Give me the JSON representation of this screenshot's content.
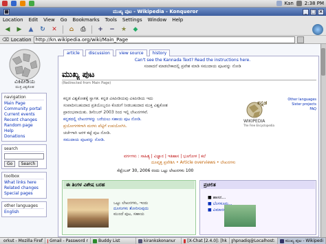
{
  "top_panel": {
    "user": "Kan",
    "clock": "2:38 PM"
  },
  "window": {
    "title": "ಮುಖ್ಯ ಪುಟ - Wikipedia - Konqueror"
  },
  "menu": [
    "Location",
    "Edit",
    "View",
    "Go",
    "Bookmarks",
    "Tools",
    "Settings",
    "Window",
    "Help"
  ],
  "location": {
    "label": "Location",
    "url": "http://kn.wikipedia.org/wiki/Main_Page"
  },
  "logo_text": "ವಿಕಿಪೀಡಿಯ",
  "logo_sub": "ಮುಕ್ತ ವಿಶ್ವಕೋಶ",
  "tabs": [
    "article",
    "discussion",
    "view source",
    "history"
  ],
  "notice": "Can't see the Kannada Text? Read the instructions here.",
  "notice2": "ಸಂಪಾದನೆ ಮಾಡಲೇಕಾದಲ್ಲಿ ಪ್ರವೇಶ ಮಾಡಿ ಸಮುದಾಯ ಪುಟವನ್ನು ನೋಡಿ",
  "heading": "ಮುಖ್ಯ ಪುಟ",
  "redirected": "(Redirected from Main Page)",
  "paragraphs": [
    "ಕನ್ನಡ ವಿಶ್ವಕೋಶಕ್ಕೆ ಸ್ವಾಗತ. ಕನ್ನಡ ವಿಕಿಪೀಡಿಯವು ವಿಕಿಪೀಡಿಯ ಇದು",
    "ಸಂಪಾದಿಸಬಹುದಾದ ಪ್ರತಿಯೊಬ್ಬರೂ ಕೊಡುಗೆ ನೀಡಬಹುದಾದ ಮುಕ್ತ ವಿಶ್ವಕೋಶ",
    "ಪ್ರಾರಂಭವಾಯಿತು. ಡಿಸೆಂಬರ್ 2003 ರಿಂದ ಇಲ್ಲಿ ಲೇಖನಗಳಿವೆ.",
    "ಕನ್ನಡದಲ್ಲಿ ಲೇಖನಗಳನ್ನು ಬರೆಯಲು ಸಹಾಯ ಪುಟ ನೋಡಿ.",
    "ಪ್ರಯೋಗಗಳಿಗಾಗಿ ಮರಳು ಪೆಟ್ಟಿಗೆ ಉಪಯೋಗಿಸಿ.",
    "ಚರ್ಚೆಗಾಗಿ ಅರಳಿ ಕಟ್ಟೆ ಪುಟ ನೋಡಿ.",
    "ಸಮುದಾಯ ಪುಟವನ್ನು ನೋಡಿ."
  ],
  "kannada_logo": {
    "top": "ಕನ್ನಡ",
    "word": "WIKIPEDIA",
    "sub": "The Free Encyclopedia"
  },
  "other_languages": [
    "Other languages",
    "Sister projects",
    "FAQ"
  ],
  "red_line": "ವರ್ಗಗಳು : ಸಾಹಿತ್ಯ | ವಿಜ್ಞಾನ | ಇತಿಹಾಸ | ಭೂಗೋಳ | ಕಲೆ",
  "org_line": "ದೂವೃತ್ತ ಪ್ರವೇಶಿಸಿ • Article overviews • ಲೇಖನಗಳು",
  "date_line": "ಸೆಪ್ಟೆಂಬರ್ 30, 2006 ರಂದು ಒಟ್ಟು ಲೇಖನಗಳು 100",
  "box_left": {
    "title": "ಈ ತಿಂಗಳ ವಿಶೇಷ ಬರಹ",
    "text": [
      "ಒಟ್ಟು ಲೇಖನಗಳು, ಇಂದು",
      "ದೂಗುಗಳು ತೋರಿಸುವುದು",
      "ಮುಂದೆ ಪುಟ, ಸಹಾಯ"
    ]
  },
  "box_right": {
    "title": "ಪ್ರಚಲಿತ",
    "items": [
      "ಹಾಸನ...",
      "ಬೆಂಗಳೂರು...",
      "ವಿಮಾನಗಳು..."
    ]
  },
  "sidebar": {
    "navigation": {
      "title": "navigation",
      "items": [
        "Main Page",
        "Community portal",
        "Current events",
        "Recent changes",
        "Random page",
        "Help",
        "Donations"
      ]
    },
    "search": {
      "title": "search",
      "go": "Go",
      "search": "Search"
    },
    "toolbox": {
      "title": "toolbox",
      "items": [
        "What links here",
        "Related changes",
        "Special pages"
      ]
    },
    "other_languages": {
      "title": "other languages",
      "items": [
        "English"
      ]
    }
  },
  "taskbar": [
    {
      "label": "orkut - Mozilla Firef",
      "color": "#e07020"
    },
    {
      "label": "Gmail - Password r",
      "color": "#d03030"
    },
    {
      "label": "Buddy List",
      "color": "#2a8a2a"
    },
    {
      "label": "kirankskonanur",
      "color": "#557"
    },
    {
      "label": "[X-Chat [2.4.0]: [hk",
      "color": "#d03030"
    },
    {
      "label": "hpnadiq@Localhost:",
      "color": "#333"
    },
    {
      "label": "ಮುಖ್ಯ ಪುಟ - Wikipedi",
      "color": "#336"
    }
  ]
}
